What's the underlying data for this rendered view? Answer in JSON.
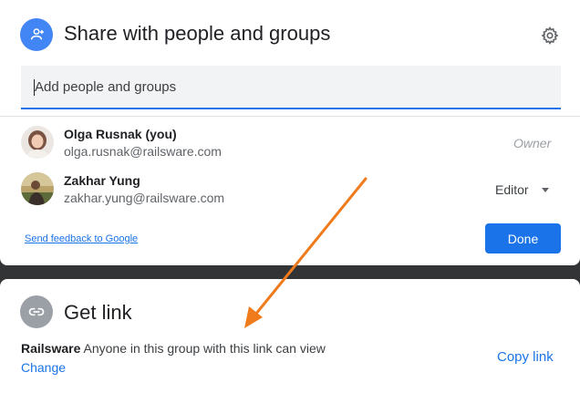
{
  "colors": {
    "accent": "#1a73e8",
    "annotation_arrow": "#f07b1c"
  },
  "share": {
    "icon": "person-add-icon",
    "title": "Share with people and groups",
    "settings_icon": "gear-icon",
    "add_field": {
      "placeholder": "Add people and groups",
      "value": ""
    },
    "people": [
      {
        "name": "Olga Rusnak (you)",
        "email": "olga.rusnak@railsware.com",
        "role": "Owner",
        "avatar": "avatar-photo-olga"
      },
      {
        "name": "Zakhar Yung",
        "email": "zakhar.yung@railsware.com",
        "role": "Editor",
        "avatar": "avatar-photo-zakhar"
      }
    ],
    "feedback_link": "Send feedback to Google",
    "done_label": "Done"
  },
  "link": {
    "icon": "link-icon",
    "title": "Get link",
    "org": "Railsware",
    "description": "Anyone in this group with this link can view",
    "change_label": "Change",
    "copy_label": "Copy link"
  }
}
